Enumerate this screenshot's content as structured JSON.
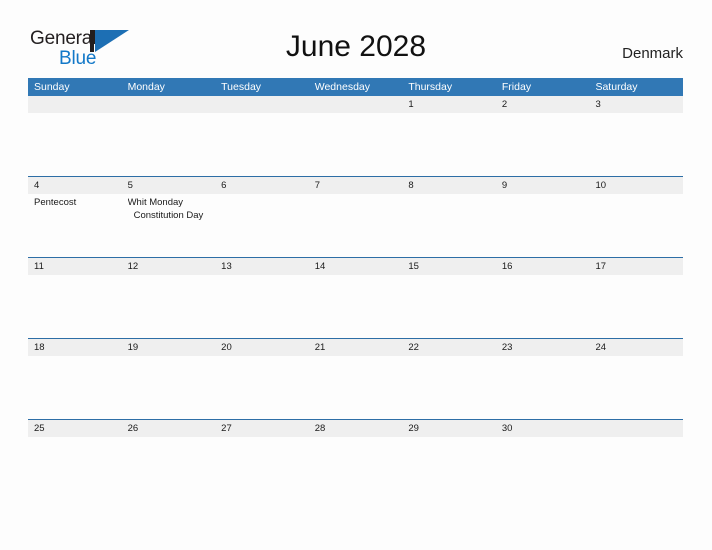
{
  "brand": {
    "name_part1": "General",
    "name_part2": "Blue",
    "mark_icon": "triangle-logo-icon",
    "accent_color": "#1278c8",
    "mark_color": "#1d6fb4"
  },
  "header": {
    "title": "June 2028",
    "region": "Denmark"
  },
  "theme": {
    "header_blue": "#3178b5",
    "row_divider_blue": "#2d6ea6",
    "date_band_gray": "#efefef",
    "page_background": "#fdfdfd"
  },
  "calendar": {
    "weekdays": [
      "Sunday",
      "Monday",
      "Tuesday",
      "Wednesday",
      "Thursday",
      "Friday",
      "Saturday"
    ],
    "weeks": [
      {
        "days": [
          {
            "date": "",
            "events": []
          },
          {
            "date": "",
            "events": []
          },
          {
            "date": "",
            "events": []
          },
          {
            "date": "",
            "events": []
          },
          {
            "date": "1",
            "events": []
          },
          {
            "date": "2",
            "events": []
          },
          {
            "date": "3",
            "events": []
          }
        ]
      },
      {
        "days": [
          {
            "date": "4",
            "events": [
              {
                "label": "Pentecost",
                "indented": false
              }
            ]
          },
          {
            "date": "5",
            "events": [
              {
                "label": "Whit Monday",
                "indented": false
              },
              {
                "label": "Constitution Day",
                "indented": true
              }
            ]
          },
          {
            "date": "6",
            "events": []
          },
          {
            "date": "7",
            "events": []
          },
          {
            "date": "8",
            "events": []
          },
          {
            "date": "9",
            "events": []
          },
          {
            "date": "10",
            "events": []
          }
        ]
      },
      {
        "days": [
          {
            "date": "11",
            "events": []
          },
          {
            "date": "12",
            "events": []
          },
          {
            "date": "13",
            "events": []
          },
          {
            "date": "14",
            "events": []
          },
          {
            "date": "15",
            "events": []
          },
          {
            "date": "16",
            "events": []
          },
          {
            "date": "17",
            "events": []
          }
        ]
      },
      {
        "days": [
          {
            "date": "18",
            "events": []
          },
          {
            "date": "19",
            "events": []
          },
          {
            "date": "20",
            "events": []
          },
          {
            "date": "21",
            "events": []
          },
          {
            "date": "22",
            "events": []
          },
          {
            "date": "23",
            "events": []
          },
          {
            "date": "24",
            "events": []
          }
        ]
      },
      {
        "days": [
          {
            "date": "25",
            "events": []
          },
          {
            "date": "26",
            "events": []
          },
          {
            "date": "27",
            "events": []
          },
          {
            "date": "28",
            "events": []
          },
          {
            "date": "29",
            "events": []
          },
          {
            "date": "30",
            "events": []
          },
          {
            "date": "",
            "events": []
          }
        ]
      }
    ]
  }
}
